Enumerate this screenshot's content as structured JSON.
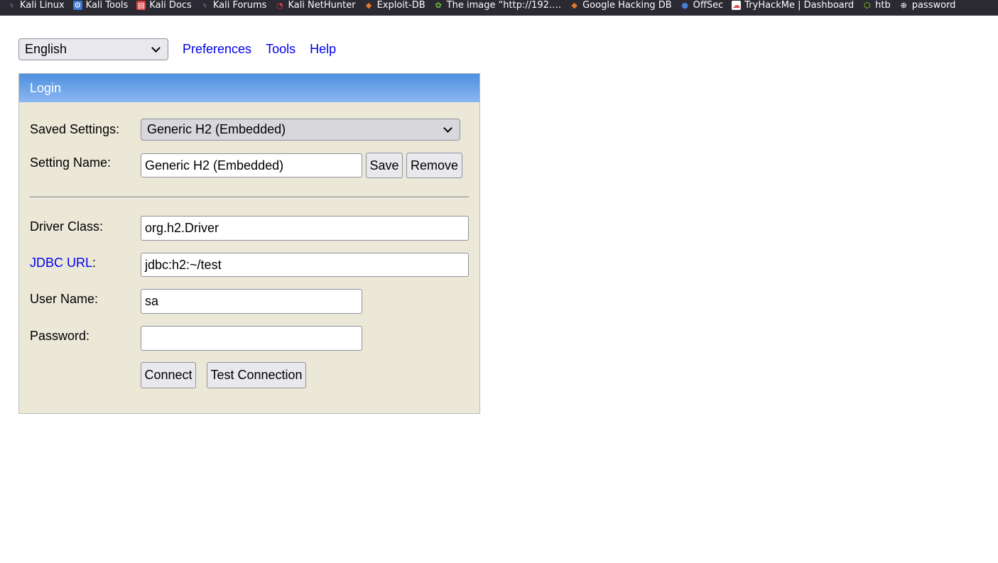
{
  "bookmarks": [
    {
      "label": "Kali Linux",
      "icon": "kali-dragon-icon",
      "color": "#9bb5d9"
    },
    {
      "label": "Kali Tools",
      "icon": "kali-tools-icon",
      "color": "#3b7bd4"
    },
    {
      "label": "Kali Docs",
      "icon": "kali-docs-icon",
      "color": "#d63b3b"
    },
    {
      "label": "Kali Forums",
      "icon": "kali-dragon-icon",
      "color": "#9bb5d9"
    },
    {
      "label": "Kali NetHunter",
      "icon": "nethunter-icon",
      "color": "#d63b3b"
    },
    {
      "label": "Exploit-DB",
      "icon": "exploit-db-icon",
      "color": "#e07b2a"
    },
    {
      "label": "The image “http://192.…",
      "icon": "image-icon",
      "color": "#6fbf3f"
    },
    {
      "label": "Google Hacking DB",
      "icon": "exploit-db-icon",
      "color": "#e07b2a"
    },
    {
      "label": "OffSec",
      "icon": "offsec-icon",
      "color": "#4a7fd6"
    },
    {
      "label": "TryHackMe | Dashboard",
      "icon": "tryhackme-icon",
      "color": "#e04848"
    },
    {
      "label": "htb",
      "icon": "htb-icon",
      "color": "#9fef00"
    },
    {
      "label": "password",
      "icon": "globe-icon",
      "color": "#fbfbfe"
    }
  ],
  "topnav": {
    "language": "English",
    "links": [
      "Preferences",
      "Tools",
      "Help"
    ]
  },
  "login": {
    "title": "Login",
    "saved_settings_label": "Saved Settings:",
    "saved_settings_value": "Generic H2 (Embedded)",
    "setting_name_label": "Setting Name:",
    "setting_name_value": "Generic H2 (Embedded)",
    "save_label": "Save",
    "remove_label": "Remove",
    "driver_class_label": "Driver Class:",
    "driver_class_value": "org.h2.Driver",
    "jdbc_url_link": "JDBC URL",
    "jdbc_url_colon": ":",
    "jdbc_url_value": "jdbc:h2:~/test",
    "user_name_label": "User Name:",
    "user_name_value": "sa",
    "password_label": "Password:",
    "password_value": "",
    "connect_label": "Connect",
    "test_connection_label": "Test Connection"
  }
}
